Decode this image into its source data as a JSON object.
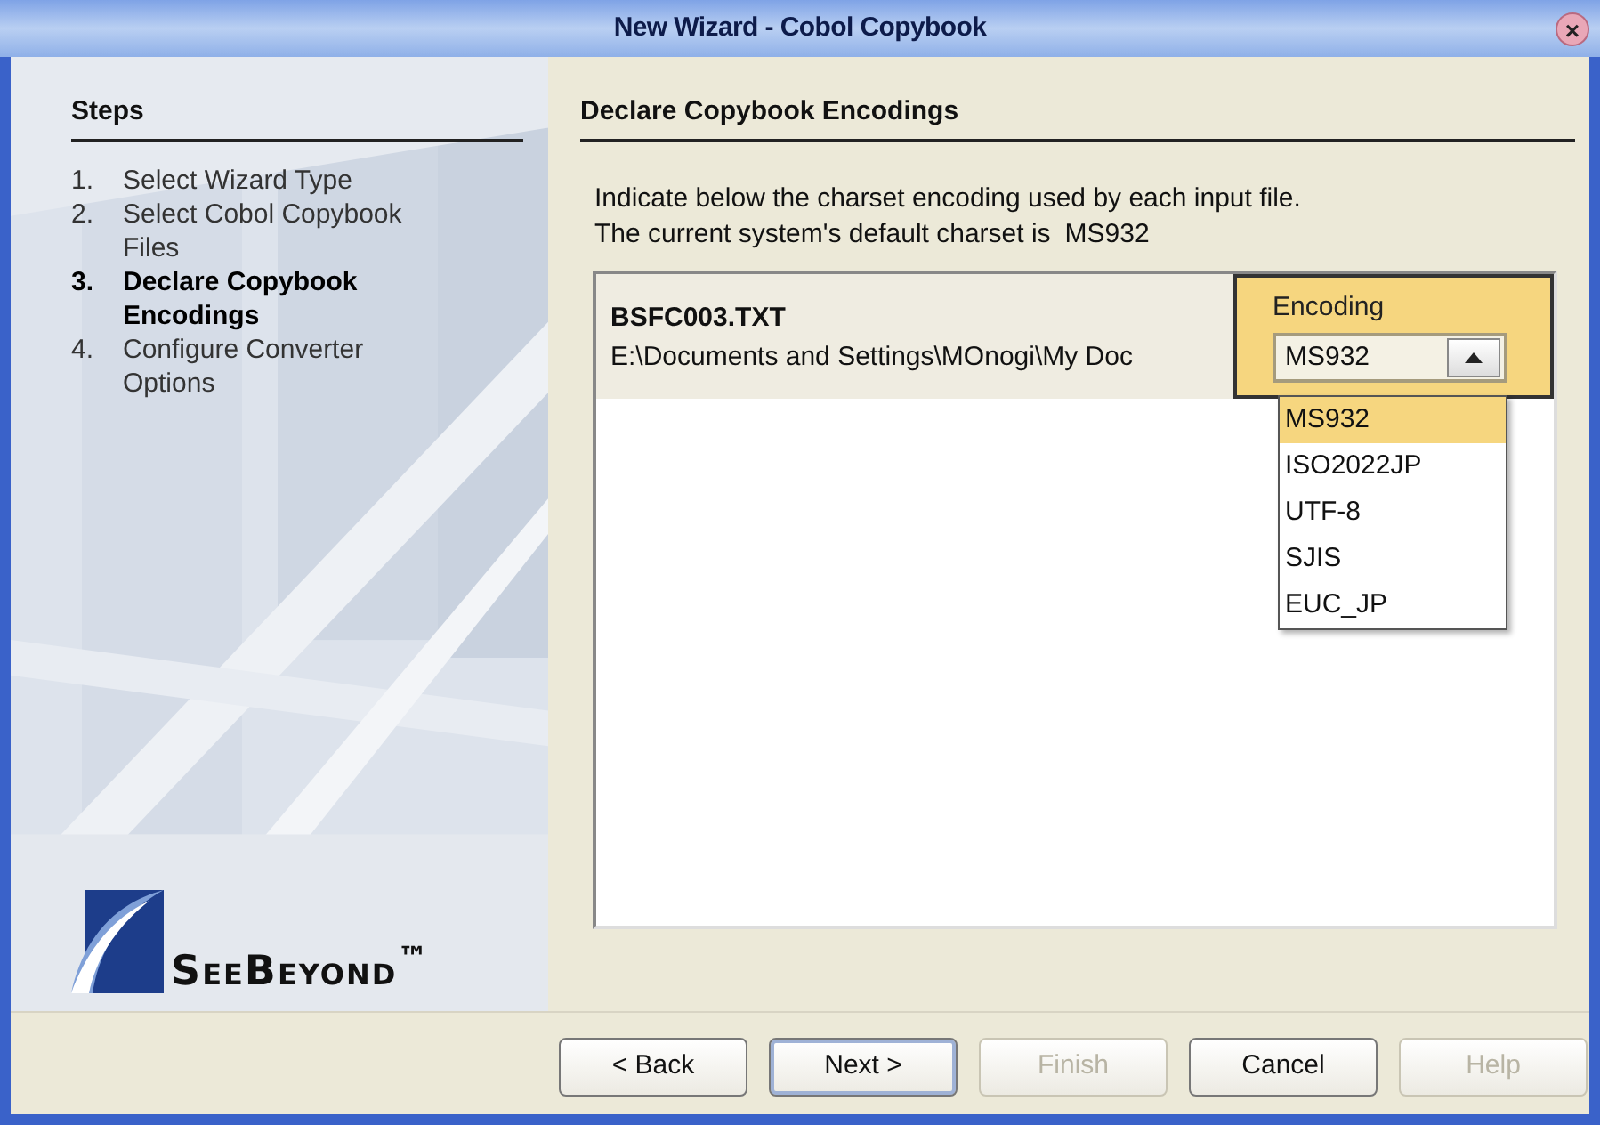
{
  "window": {
    "title": "New Wizard - Cobol Copybook",
    "close": "×"
  },
  "steps": {
    "heading": "Steps",
    "items": [
      {
        "number": "1.",
        "label": "Select Wizard Type",
        "selected": false
      },
      {
        "number": "2.",
        "label": "Select Cobol Copybook Files",
        "selected": false
      },
      {
        "number": "3.",
        "label": "Declare Copybook Encodings",
        "selected": true
      },
      {
        "number": "4.",
        "label": "Configure Converter Options",
        "selected": false
      }
    ],
    "logo": "SeeBeyond$^{™}$"
  },
  "page": {
    "heading": "Declare Copybook Encodings",
    "intro": "Indicate below the charset encoding used by each input file.",
    "default_label": "The current system's default charset is",
    "default_value": "MS932"
  },
  "files": [
    {
      "name": "BSFC003.TXT",
      "path": "E:\\Documents and Settings\\MOnogi\\My Doc",
      "encoding_label": "Encoding",
      "encoding": "MS932",
      "expanded": true,
      "options": [
        {
          "label": "MS932",
          "selected": true
        },
        {
          "label": "ISO2022JP",
          "selected": false
        },
        {
          "label": "UTF-8",
          "selected": false
        },
        {
          "label": "SJIS",
          "selected": false
        },
        {
          "label": "EUC_JP",
          "selected": false
        }
      ]
    }
  ],
  "buttons": [
    {
      "label": "< Back",
      "default": false,
      "disabled": false
    },
    {
      "label": "Next >",
      "default": true,
      "disabled": false
    },
    {
      "label": "Finish",
      "default": false,
      "disabled": true
    },
    {
      "label": "Cancel",
      "default": false,
      "disabled": false
    },
    {
      "label": "Help",
      "default": false,
      "disabled": true
    }
  ]
}
